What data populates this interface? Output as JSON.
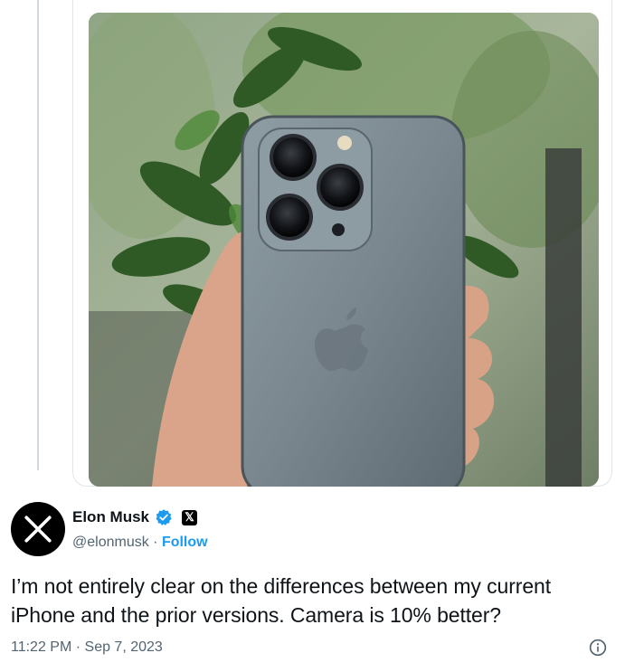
{
  "tweet": {
    "author_name": "Elon Musk",
    "handle": "@elonmusk",
    "separator": " · ",
    "follow_label": "Follow",
    "text": "I’m not entirely clear on the differences between my current iPhone and the prior versions. Camera is 10% better?",
    "timestamp": "11:22 PM · Sep 7, 2023",
    "x_badge_label": "𝕏"
  },
  "icons": {
    "avatar": "x-logo-icon",
    "verified": "verified-badge-icon",
    "affiliation": "x-affiliation-icon",
    "info": "info-icon"
  },
  "colors": {
    "accent": "#1d9bf0",
    "text": "#0f1419",
    "muted": "#536471"
  }
}
